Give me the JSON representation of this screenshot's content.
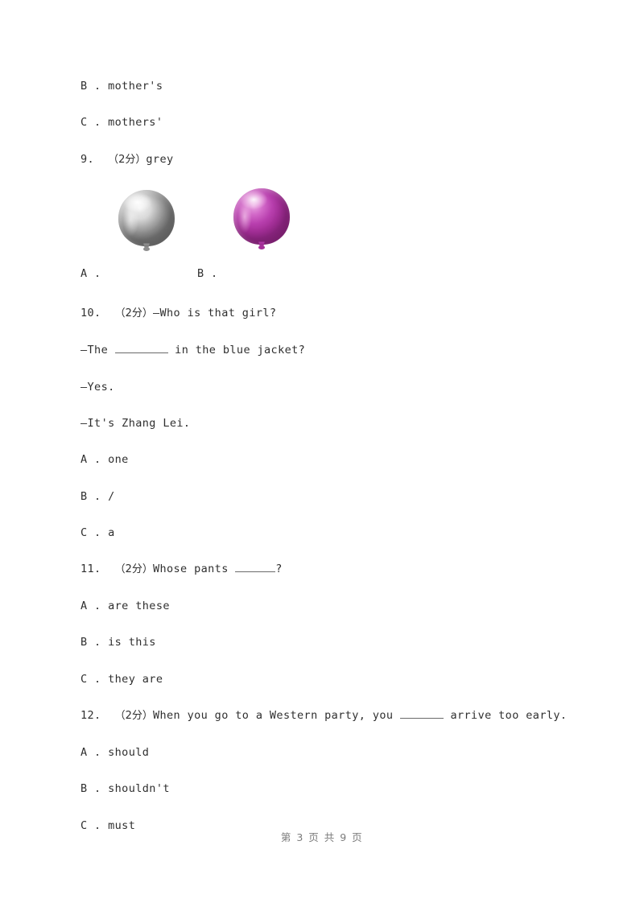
{
  "document": {
    "page_footer": "第 3 页 共 9 页"
  },
  "questions": [
    {
      "id": "q8-tail",
      "options": [
        {
          "label": "B .",
          "text": " mother's"
        },
        {
          "label": "C .",
          "text": " mothers'"
        }
      ]
    },
    {
      "id": "q9",
      "number": "9.",
      "points": "（2分）",
      "stem": "grey",
      "figure": {
        "items": [
          {
            "label": "A .",
            "image": "grey-balloon",
            "color": "#a8a8a8"
          },
          {
            "label": "B .",
            "image": "magenta-balloon",
            "color": "#b83fae"
          }
        ]
      }
    },
    {
      "id": "q10",
      "number": "10.",
      "points": "（2分）",
      "stem": "—Who is that girl?",
      "dialogue": [
        {
          "before": "—The ",
          "blank": true,
          "after": " in the blue jacket?"
        },
        {
          "before": "—Yes.",
          "blank": false,
          "after": ""
        },
        {
          "before": "—It's Zhang Lei.",
          "blank": false,
          "after": ""
        }
      ],
      "options": [
        {
          "label": "A .",
          "text": " one"
        },
        {
          "label": "B .",
          "text": " /"
        },
        {
          "label": "C .",
          "text": " a"
        }
      ]
    },
    {
      "id": "q11",
      "number": "11.",
      "points": "（2分）",
      "stem_before": "Whose pants ",
      "stem_after": "?",
      "options": [
        {
          "label": "A .",
          "text": " are these"
        },
        {
          "label": "B .",
          "text": " is this"
        },
        {
          "label": "C .",
          "text": " they are"
        }
      ]
    },
    {
      "id": "q12",
      "number": "12.",
      "points": "（2分）",
      "stem_before": "When you go to a Western party, you ",
      "stem_after": " arrive too early.",
      "options": [
        {
          "label": "A .",
          "text": " should"
        },
        {
          "label": "B .",
          "text": " shouldn't"
        },
        {
          "label": "C .",
          "text": " must"
        }
      ]
    }
  ]
}
